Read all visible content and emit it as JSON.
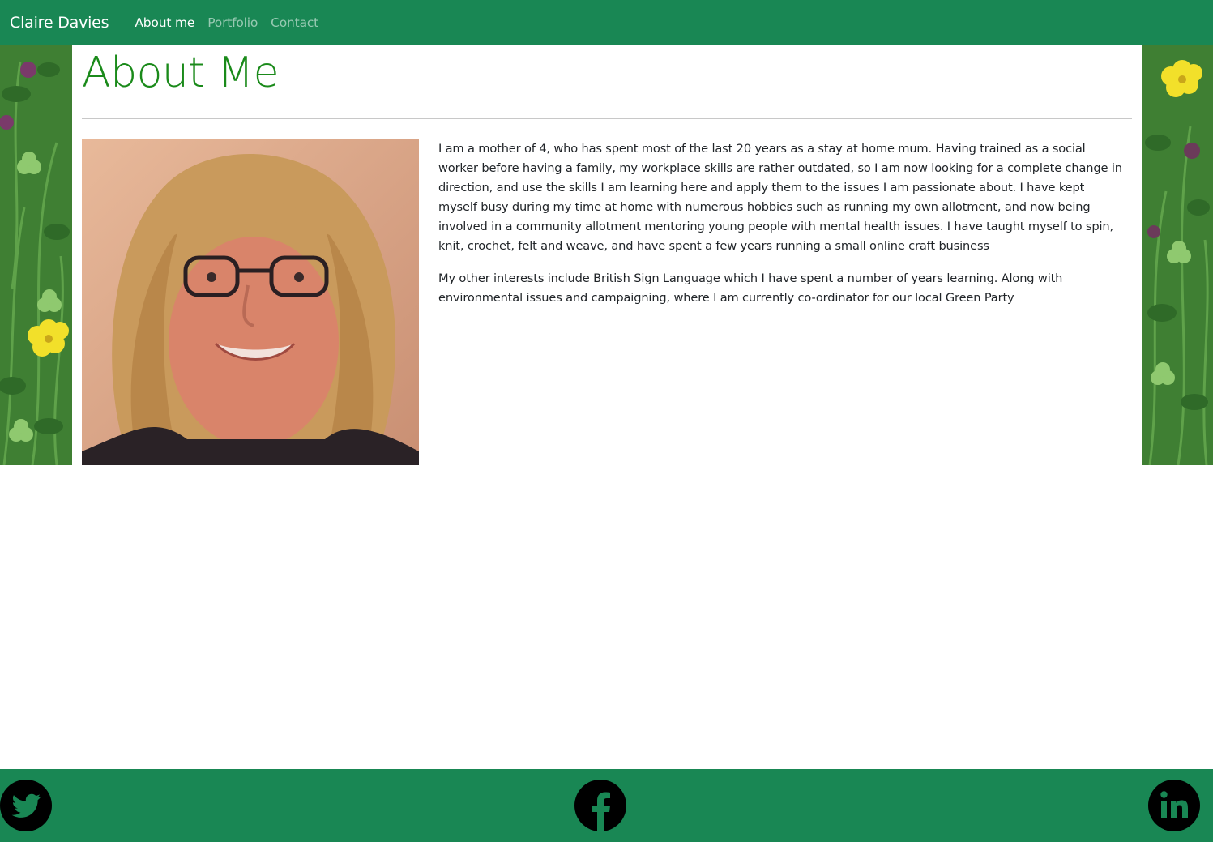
{
  "navbar": {
    "brand": "Claire Davies",
    "links": [
      {
        "label": "About me",
        "active": true
      },
      {
        "label": "Portfolio",
        "active": false
      },
      {
        "label": "Contact",
        "active": false
      }
    ]
  },
  "main": {
    "title": "About Me",
    "bio_paragraphs": [
      "I am a mother of 4, who has spent most of the last 20 years as a stay at home mum. Having trained as a social worker before having a family, my workplace skills are rather outdated, so I am now looking for a complete change in direction, and use the skills I am learning here and apply them to the issues I am passionate about. I have kept myself busy during my time at home with numerous hobbies such as running my own allotment, and now being involved in a community allotment mentoring young people with mental health issues. I have taught myself to spin, knit, crochet, felt and weave, and have spent a few years running a small online craft business",
      "My other interests include British Sign Language which I have spent a number of years learning. Along with environmental issues and campaigning, where I am currently co-ordinator for our local Green Party"
    ]
  },
  "footer": {
    "icons": [
      "twitter-icon",
      "facebook-icon",
      "linkedin-icon"
    ]
  },
  "colors": {
    "primary_green": "#198754",
    "title_green": "#1a8a1a",
    "text": "#212529"
  }
}
